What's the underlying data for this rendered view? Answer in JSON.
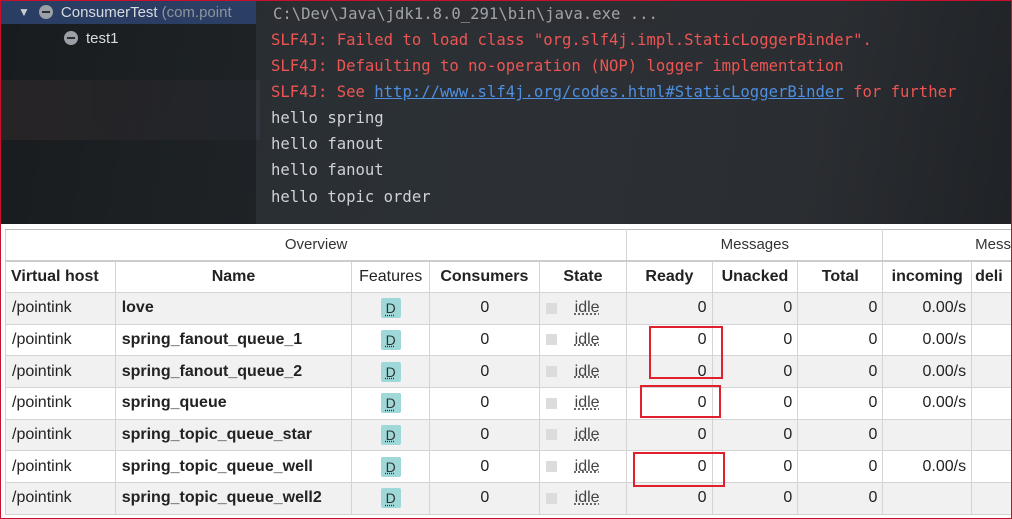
{
  "ide": {
    "tree": {
      "root": {
        "label": "ConsumerTest",
        "package": "(com.point"
      },
      "child": {
        "label": "test1"
      }
    },
    "console": {
      "lines": [
        {
          "text": "C:\\Dev\\Java\\jdk1.8.0_291\\bin\\java.exe ..."
        },
        {
          "text": "SLF4J: Failed to load class \"org.slf4j.impl.StaticLoggerBinder\"."
        },
        {
          "text": "SLF4J: Defaulting to no-operation (NOP) logger implementation"
        },
        {
          "prefix": "SLF4J: See ",
          "link": "http://www.slf4j.org/codes.html#StaticLoggerBinder",
          "suffix": " for further"
        },
        {
          "text": "hello spring"
        },
        {
          "text": "hello fanout"
        },
        {
          "text": "hello fanout"
        },
        {
          "text": "hello topic order"
        }
      ]
    }
  },
  "queues": {
    "groups": {
      "overview": "Overview",
      "messages": "Messages",
      "message_rates": "Mess"
    },
    "headers": {
      "vhost": "Virtual host",
      "name": "Name",
      "features": "Features",
      "consumers": "Consumers",
      "state": "State",
      "ready": "Ready",
      "unacked": "Unacked",
      "total": "Total",
      "incoming": "incoming",
      "deliver": "deli"
    },
    "rows": [
      {
        "vhost": "/pointink",
        "name": "love",
        "feature": "D",
        "consumers": "0",
        "state": "idle",
        "ready": "0",
        "unacked": "0",
        "total": "0",
        "incoming": "0.00/s"
      },
      {
        "vhost": "/pointink",
        "name": "spring_fanout_queue_1",
        "feature": "D",
        "consumers": "0",
        "state": "idle",
        "ready": "0",
        "unacked": "0",
        "total": "0",
        "incoming": "0.00/s"
      },
      {
        "vhost": "/pointink",
        "name": "spring_fanout_queue_2",
        "feature": "D",
        "consumers": "0",
        "state": "idle",
        "ready": "0",
        "unacked": "0",
        "total": "0",
        "incoming": "0.00/s"
      },
      {
        "vhost": "/pointink",
        "name": "spring_queue",
        "feature": "D",
        "consumers": "0",
        "state": "idle",
        "ready": "0",
        "unacked": "0",
        "total": "0",
        "incoming": "0.00/s"
      },
      {
        "vhost": "/pointink",
        "name": "spring_topic_queue_star",
        "feature": "D",
        "consumers": "0",
        "state": "idle",
        "ready": "0",
        "unacked": "0",
        "total": "0",
        "incoming": ""
      },
      {
        "vhost": "/pointink",
        "name": "spring_topic_queue_well",
        "feature": "D",
        "consumers": "0",
        "state": "idle",
        "ready": "0",
        "unacked": "0",
        "total": "0",
        "incoming": "0.00/s"
      },
      {
        "vhost": "/pointink",
        "name": "spring_topic_queue_well2",
        "feature": "D",
        "consumers": "0",
        "state": "idle",
        "ready": "0",
        "unacked": "0",
        "total": "0",
        "incoming": ""
      }
    ]
  },
  "colors": {
    "highlight": "#e0202c",
    "error_text": "#ee5552",
    "link": "#4e8fe0",
    "feature_badge": "#9fd8d8"
  }
}
